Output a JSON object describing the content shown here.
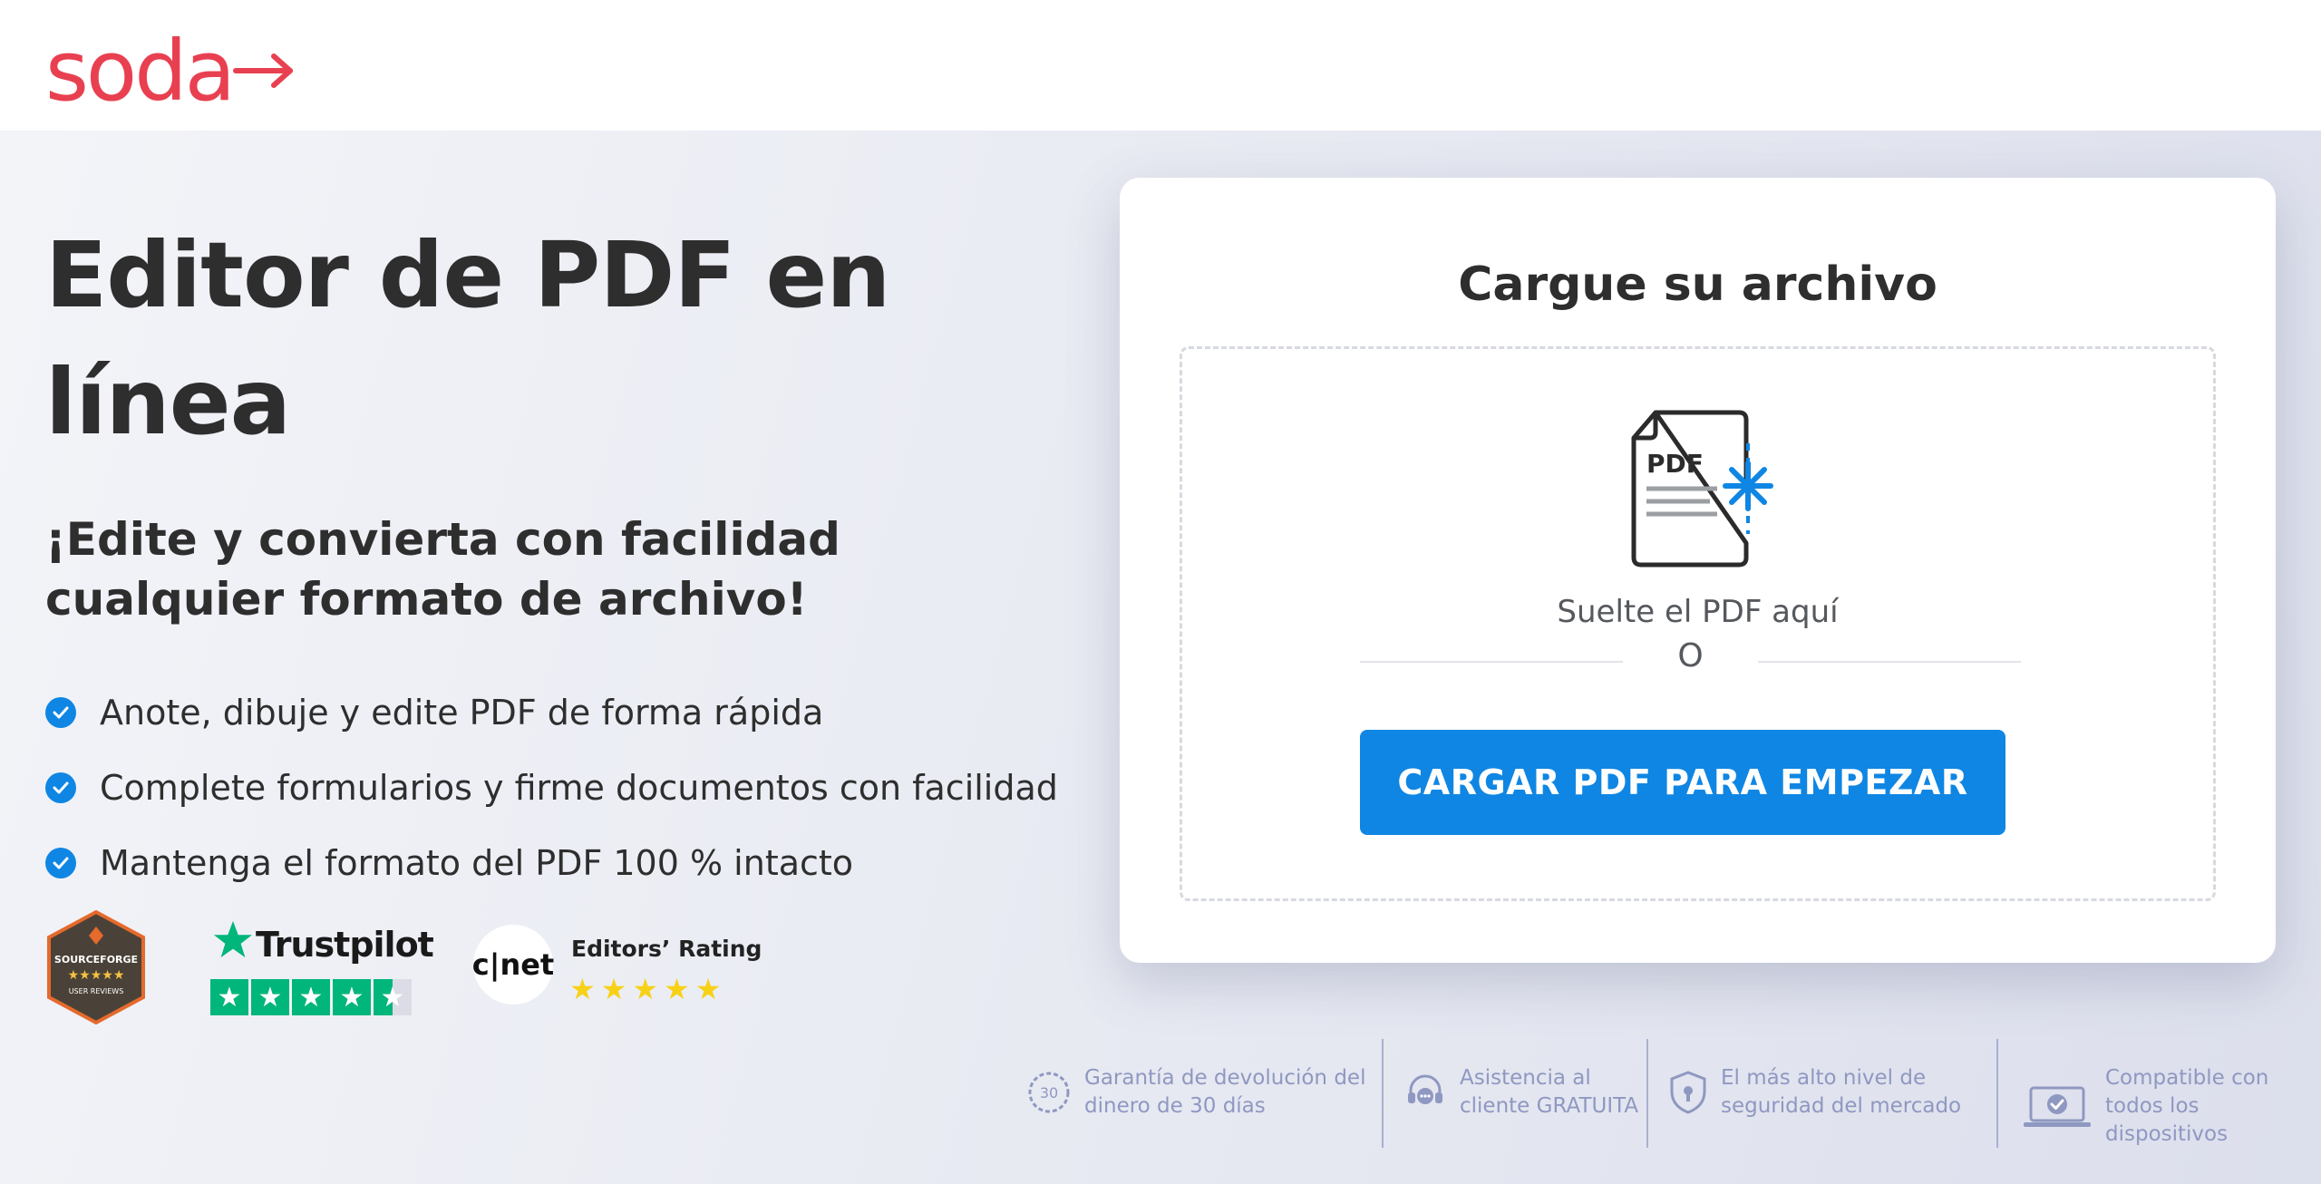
{
  "brand": {
    "name": "soda",
    "color": "#e84050"
  },
  "hero": {
    "headline": "Editor de PDF en línea",
    "subheadline": "¡Edite y convierta con facilidad cualquier formato de archivo!",
    "features": [
      "Anote, dibuje y edite PDF de forma rápida",
      "Complete formularios y firme documentos con facilidad",
      "Mantenga el formato del PDF 100 % intacto"
    ]
  },
  "upload": {
    "title": "Cargue su archivo",
    "icon_label": "PDF",
    "drop_text": "Suelte el PDF aquí",
    "or_text": "O",
    "button_label": "CARGAR PDF PARA EMPEZAR",
    "accent": "#0f86e3"
  },
  "badges": {
    "sourceforge": {
      "name": "SOURCEFORGE",
      "sub": "USER REVIEWS"
    },
    "trustpilot": {
      "name": "Trustpilot",
      "stars": 4.5
    },
    "cnet": {
      "logo": "c|net",
      "title": "Editors’ Rating",
      "stars": 5
    }
  },
  "guarantees": [
    {
      "icon": "money-back-icon",
      "line1": "Garantía de devolución del",
      "line2": "dinero de 30 días",
      "icon_text": "30"
    },
    {
      "icon": "support-icon",
      "line1": "Asistencia al",
      "line2": "cliente GRATUITA"
    },
    {
      "icon": "security-shield-icon",
      "line1": "El más alto nivel de",
      "line2": "seguridad del mercado"
    },
    {
      "icon": "laptop-check-icon",
      "line1": "Compatible con",
      "line2": "todos los dispositivos"
    }
  ],
  "colors": {
    "guarantee_text": "#8f98c1",
    "heading": "#2e2e2e"
  }
}
